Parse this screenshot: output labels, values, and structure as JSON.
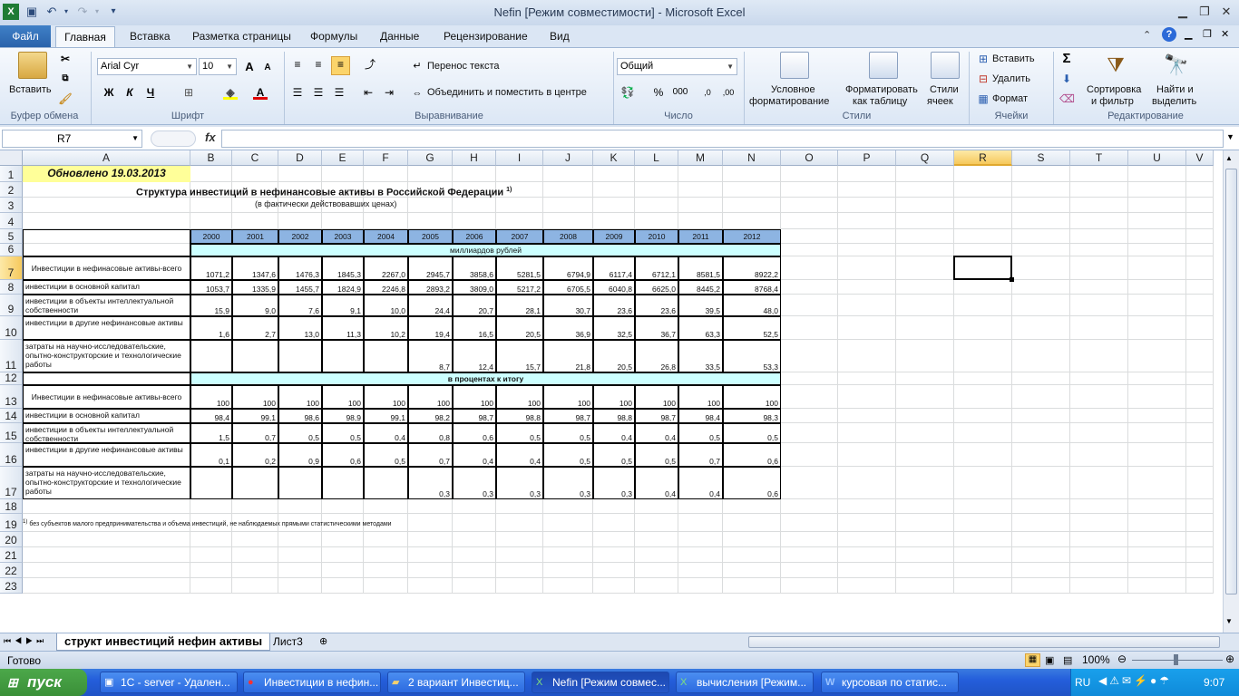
{
  "window": {
    "title": "Nefin  [Режим совместимости]  -  Microsoft Excel"
  },
  "ribbon_tabs": [
    "Файл",
    "Главная",
    "Вставка",
    "Разметка страницы",
    "Формулы",
    "Данные",
    "Рецензирование",
    "Вид"
  ],
  "ribbon": {
    "paste": "Вставить",
    "font_name": "Arial Cyr",
    "font_size": "10",
    "wrap_text": "Перенос текста",
    "merge_center": "Объединить и поместить в центре",
    "number_format": "Общий",
    "conditional_1": "Условное",
    "conditional_2": "форматирование",
    "format_table_1": "Форматировать",
    "format_table_2": "как таблицу",
    "cell_styles_1": "Стили",
    "cell_styles_2": "ячеек",
    "insert": "Вставить",
    "delete": "Удалить",
    "format": "Формат",
    "sort_1": "Сортировка",
    "sort_2": "и фильтр",
    "find_1": "Найти и",
    "find_2": "выделить",
    "groups": {
      "clipboard": "Буфер обмена",
      "font": "Шрифт",
      "alignment": "Выравнивание",
      "number": "Число",
      "styles": "Стили",
      "cells": "Ячейки",
      "editing": "Редактирование"
    }
  },
  "formula_bar": {
    "name_box": "R7",
    "fx": "fx",
    "formula": ""
  },
  "columns": [
    "A",
    "B",
    "C",
    "D",
    "E",
    "F",
    "G",
    "H",
    "I",
    "J",
    "K",
    "L",
    "M",
    "N",
    "O",
    "P",
    "Q",
    "R",
    "S",
    "T",
    "U",
    "V"
  ],
  "rows": [
    "1",
    "2",
    "3",
    "4",
    "5",
    "6",
    "7",
    "8",
    "9",
    "10",
    "11",
    "12",
    "13",
    "14",
    "15",
    "16",
    "17",
    "18",
    "19",
    "20",
    "21",
    "22",
    "23"
  ],
  "sheet": {
    "updated": "Обновлено 19.03.2013",
    "title": "Структура инвестиций в нефинансовые активы в Российской Федерации",
    "title_sup": "1)",
    "subtitle": "(в фактически действовавших ценах)",
    "years": [
      "2000",
      "2001",
      "2002",
      "2003",
      "2004",
      "2005",
      "2006",
      "2007",
      "2008",
      "2009",
      "2010",
      "2011",
      "2012"
    ],
    "section1": "миллиардов рублей",
    "section2": "в процентах к итогу",
    "block1": [
      {
        "label": "Инвестиции в нефинасовые активы-всего",
        "values": [
          "1071,2",
          "1347,6",
          "1476,3",
          "1845,3",
          "2267,0",
          "2945,7",
          "3858,6",
          "5281,5",
          "6794,9",
          "6117,4",
          "6712,1",
          "8581,5",
          "8922,2"
        ]
      },
      {
        "label": "инвестиции в основной капитал",
        "values": [
          "1053,7",
          "1335,9",
          "1455,7",
          "1824,9",
          "2246,8",
          "2893,2",
          "3809,0",
          "5217,2",
          "6705,5",
          "6040,8",
          "6625,0",
          "8445,2",
          "8768,4"
        ]
      },
      {
        "label": "инвестиции в объекты интеллектуальной собственности",
        "values": [
          "15,9",
          "9,0",
          "7,6",
          "9,1",
          "10,0",
          "24,4",
          "20,7",
          "28,1",
          "30,7",
          "23,6",
          "23,6",
          "39,5",
          "48,0"
        ]
      },
      {
        "label": "инвестиции в другие нефинансовые активы",
        "values": [
          "1,6",
          "2,7",
          "13,0",
          "11,3",
          "10,2",
          "19,4",
          "16,5",
          "20,5",
          "36,9",
          "32,5",
          "36,7",
          "63,3",
          "52,5"
        ]
      },
      {
        "label": "затраты на научно-исследовательские, опытно-конструкторские и технологические работы",
        "values": [
          "",
          "",
          "",
          "",
          "",
          "8,7",
          "12,4",
          "15,7",
          "21,8",
          "20,5",
          "26,8",
          "33,5",
          "53,3"
        ]
      }
    ],
    "block2": [
      {
        "label": "Инвестиции в нефинасовые активы-всего",
        "values": [
          "100",
          "100",
          "100",
          "100",
          "100",
          "100",
          "100",
          "100",
          "100",
          "100",
          "100",
          "100",
          "100"
        ]
      },
      {
        "label": "инвестиции в основной капитал",
        "values": [
          "98,4",
          "99,1",
          "98,6",
          "98,9",
          "99,1",
          "98,2",
          "98,7",
          "98,8",
          "98,7",
          "98,8",
          "98,7",
          "98,4",
          "98,3"
        ]
      },
      {
        "label": "инвестиции в объекты интеллектуальной собственности",
        "values": [
          "1,5",
          "0,7",
          "0,5",
          "0,5",
          "0,4",
          "0,8",
          "0,6",
          "0,5",
          "0,5",
          "0,4",
          "0,4",
          "0,5",
          "0,5"
        ]
      },
      {
        "label": "инвестиции в другие нефинансовые активы",
        "values": [
          "0,1",
          "0,2",
          "0,9",
          "0,6",
          "0,5",
          "0,7",
          "0,4",
          "0,4",
          "0,5",
          "0,5",
          "0,5",
          "0,7",
          "0,6"
        ]
      },
      {
        "label": "затраты на научно-исследовательские, опытно-конструкторские и технологические работы",
        "values": [
          "",
          "",
          "",
          "",
          "",
          "0,3",
          "0,3",
          "0,3",
          "0,3",
          "0,3",
          "0,4",
          "0,4",
          "0,6"
        ]
      }
    ],
    "footnote_sup": "1)",
    "footnote": "без субъектов малого предпринимательства и объема инвестиций, не наблюдаемых прямыми статистическими методами"
  },
  "sheet_tabs": [
    "структ инвестиций нефин активы",
    "Лист3"
  ],
  "status": {
    "ready": "Готово",
    "zoom": "100%"
  },
  "taskbar": {
    "start": "пуск",
    "items": [
      "1С - server - Удален...",
      "Инвестиции в нефин...",
      "2 вариант Инвестиц...",
      "Nefin  [Режим совмес...",
      "вычисления  [Режим...",
      "курсовая по статис..."
    ],
    "lang": "RU",
    "clock": "9:07"
  }
}
